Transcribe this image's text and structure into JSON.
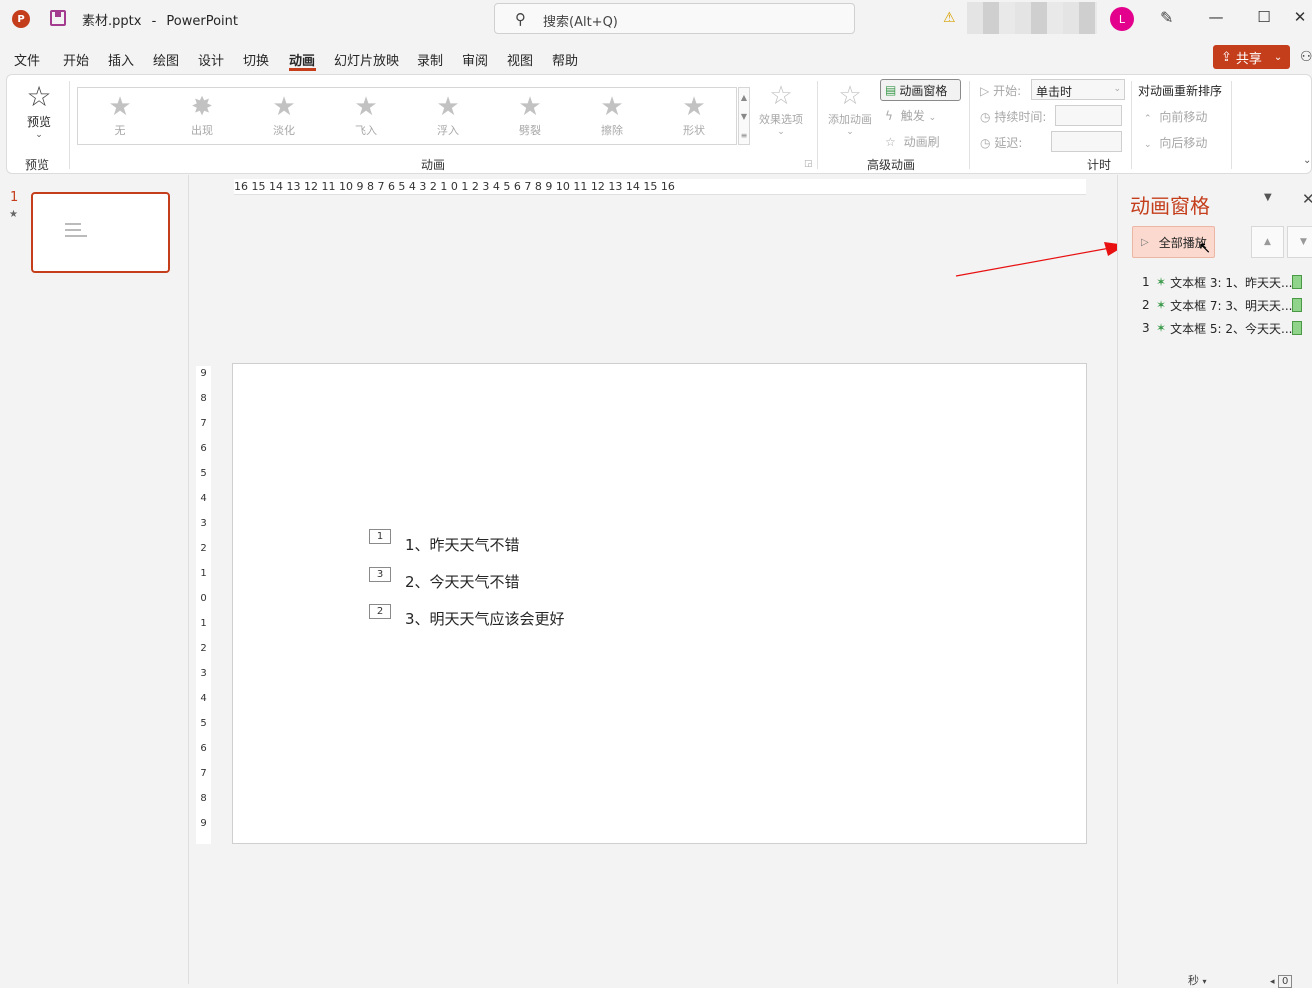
{
  "titlebar": {
    "logo_letter": "P",
    "doc_name": "素材.pptx",
    "separator": "-",
    "app_name": "PowerPoint",
    "search_placeholder": "搜索(Alt+Q)",
    "avatar_letter": "L"
  },
  "menu": [
    "文件",
    "开始",
    "插入",
    "绘图",
    "设计",
    "切换",
    "动画",
    "幻灯片放映",
    "录制",
    "审阅",
    "视图",
    "帮助"
  ],
  "menu_active": "动画",
  "share_label": "共享",
  "ribbon": {
    "preview": {
      "label": "预览",
      "group": "预览"
    },
    "animations": {
      "group": "动画",
      "gallery": [
        "无",
        "出现",
        "淡化",
        "飞入",
        "浮入",
        "劈裂",
        "擦除",
        "形状"
      ],
      "effect_options": "效果选项"
    },
    "advanced": {
      "group": "高级动画",
      "add_animation": "添加动画",
      "animation_pane": "动画窗格",
      "trigger": "触发",
      "painter": "动画刷"
    },
    "timing": {
      "group": "计时",
      "start_label": "开始:",
      "start_value": "单击时",
      "duration_label": "持续时间:",
      "delay_label": "延迟:"
    },
    "reorder": {
      "title": "对动画重新排序",
      "move_earlier": "向前移动",
      "move_later": "向后移动"
    }
  },
  "thumbnails": {
    "slide_number": "1"
  },
  "ruler": {
    "horizontal": "16 15 14 13 12 11 10 9 8 7 6 5 4 3 2 1 0 1 2 3 4 5 6 7 8 9 10 11 12 13 14 15 16",
    "vertical": [
      "9",
      "8",
      "7",
      "6",
      "5",
      "4",
      "3",
      "2",
      "1",
      "0",
      "1",
      "2",
      "3",
      "4",
      "5",
      "6",
      "7",
      "8",
      "9"
    ]
  },
  "slide": {
    "items": [
      {
        "tag": "1",
        "text": "1、昨天天气不错"
      },
      {
        "tag": "3",
        "text": "2、今天天气不错"
      },
      {
        "tag": "2",
        "text": "3、明天天气应该会更好"
      }
    ]
  },
  "animation_pane": {
    "title": "动画窗格",
    "play_all": "全部播放",
    "rows": [
      {
        "num": "1",
        "text": "文本框 3: 1、昨天天..."
      },
      {
        "num": "2",
        "text": "文本框 7: 3、明天天..."
      },
      {
        "num": "3",
        "text": "文本框 5: 2、今天天..."
      }
    ]
  },
  "status": {
    "seconds": "秒",
    "zoom_box": "0"
  },
  "colors": {
    "accent": "#c43e1c",
    "highlight": "#fbd9cf",
    "avatar": "#e3008c",
    "annotation_arrow": "#e81010"
  }
}
